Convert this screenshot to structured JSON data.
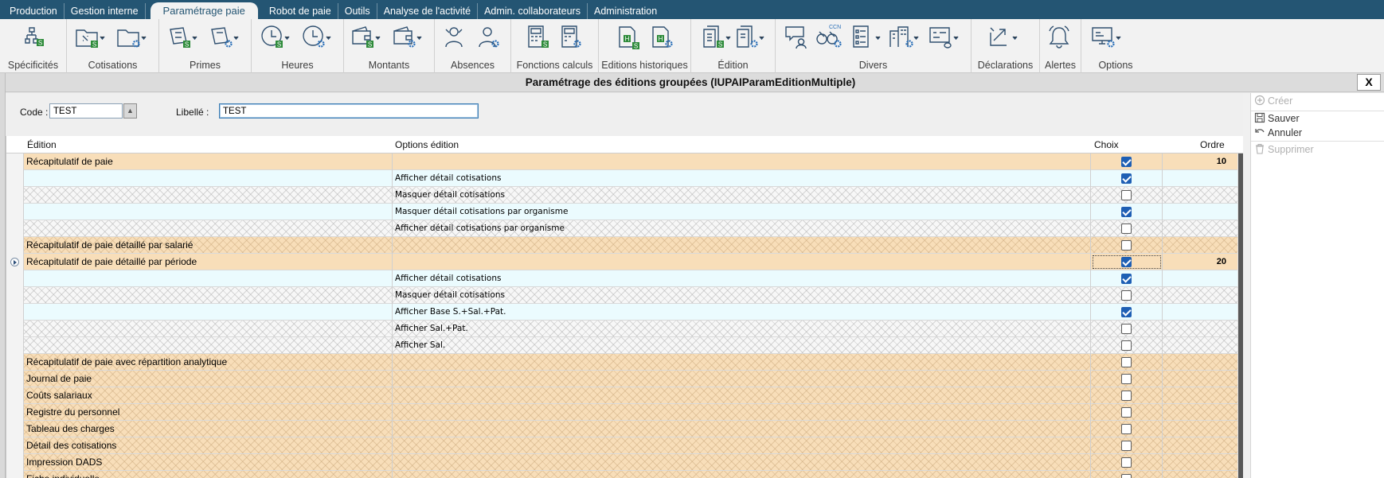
{
  "menu": [
    {
      "label": "Production",
      "active": false
    },
    {
      "label": "Gestion interne",
      "active": false
    },
    {
      "label": "Paramétrage paie",
      "active": true
    },
    {
      "label": "Robot de paie",
      "active": false
    },
    {
      "label": "Outils",
      "active": false
    },
    {
      "label": "Analyse de l'activité",
      "active": false
    },
    {
      "label": "Admin. collaborateurs",
      "active": false
    },
    {
      "label": "Administration",
      "active": false
    }
  ],
  "ribbon": {
    "specificites": "Spécificités",
    "cotisations": "Cotisations",
    "primes": "Primes",
    "heures": "Heures",
    "montants": "Montants",
    "absences": "Absences",
    "fonctions_calculs": "Fonctions calculs",
    "editions_historiques": "Editions historiques",
    "edition": "Édition",
    "divers": "Divers",
    "declarations": "Déclarations",
    "alertes": "Alertes",
    "options": "Options",
    "badge_s": "S",
    "badge_h": "H",
    "ccn": "CCN"
  },
  "window": {
    "title": "Paramétrage des éditions groupées (IUPAIParamEditionMultiple)",
    "close": "X"
  },
  "form": {
    "code_label": "Code :",
    "code_value": "TEST",
    "libelle_label": "Libellé :",
    "libelle_value": "TEST"
  },
  "grid": {
    "headers": {
      "edition": "Édition",
      "options": "Options édition",
      "choix": "Choix",
      "ordre": "Ordre"
    },
    "rows": [
      {
        "type": "parent",
        "edition": "Récapitulatif de paie",
        "option": "",
        "checked": true,
        "ordre": "10",
        "pattern": false
      },
      {
        "type": "child",
        "edition": "",
        "option": "Afficher détail cotisations",
        "checked": true,
        "ordre": "",
        "pattern": false
      },
      {
        "type": "child",
        "edition": "",
        "option": "Masquer détail cotisations",
        "checked": false,
        "ordre": "",
        "pattern": true
      },
      {
        "type": "child",
        "edition": "",
        "option": "Masquer détail cotisations par organisme",
        "checked": true,
        "ordre": "",
        "pattern": false
      },
      {
        "type": "child",
        "edition": "",
        "option": "Afficher détail cotisations par organisme",
        "checked": false,
        "ordre": "",
        "pattern": true
      },
      {
        "type": "parent",
        "edition": "Récapitulatif de paie détaillé par salarié",
        "option": "",
        "checked": false,
        "ordre": "",
        "pattern": true
      },
      {
        "type": "parent",
        "edition": "Récapitulatif de paie détaillé par période",
        "option": "",
        "checked": true,
        "ordre": "20",
        "pattern": false,
        "current": true
      },
      {
        "type": "child",
        "edition": "",
        "option": "Afficher détail cotisations",
        "checked": true,
        "ordre": "",
        "pattern": false
      },
      {
        "type": "child",
        "edition": "",
        "option": "Masquer détail cotisations",
        "checked": false,
        "ordre": "",
        "pattern": true
      },
      {
        "type": "child",
        "edition": "",
        "option": "Afficher Base S.+Sal.+Pat.",
        "checked": true,
        "ordre": "",
        "pattern": false
      },
      {
        "type": "child",
        "edition": "",
        "option": "Afficher Sal.+Pat.",
        "checked": false,
        "ordre": "",
        "pattern": true
      },
      {
        "type": "child",
        "edition": "",
        "option": "Afficher Sal.",
        "checked": false,
        "ordre": "",
        "pattern": true
      },
      {
        "type": "parent",
        "edition": "Récapitulatif de paie avec répartition analytique",
        "option": "",
        "checked": false,
        "ordre": "",
        "pattern": true
      },
      {
        "type": "parent",
        "edition": "Journal de paie",
        "option": "",
        "checked": false,
        "ordre": "",
        "pattern": true
      },
      {
        "type": "parent",
        "edition": "Coûts salariaux",
        "option": "",
        "checked": false,
        "ordre": "",
        "pattern": true
      },
      {
        "type": "parent",
        "edition": "Registre du personnel",
        "option": "",
        "checked": false,
        "ordre": "",
        "pattern": true
      },
      {
        "type": "parent",
        "edition": "Tableau des charges",
        "option": "",
        "checked": false,
        "ordre": "",
        "pattern": true
      },
      {
        "type": "parent",
        "edition": "Détail des cotisations",
        "option": "",
        "checked": false,
        "ordre": "",
        "pattern": true
      },
      {
        "type": "parent",
        "edition": "Impression DADS",
        "option": "",
        "checked": false,
        "ordre": "",
        "pattern": true
      },
      {
        "type": "parent",
        "edition": "Fiche individuelle",
        "option": "",
        "checked": false,
        "ordre": "",
        "pattern": true
      }
    ]
  },
  "actions": {
    "creer": "Créer",
    "sauver": "Sauver",
    "annuler": "Annuler",
    "supprimer": "Supprimer"
  },
  "colors": {
    "menubar": "#245573",
    "parent_row": "#f8deb9",
    "child_row": "#ebfbfe",
    "checkbox_on": "#1e5fb4",
    "badge_green": "#2e8b3a"
  }
}
